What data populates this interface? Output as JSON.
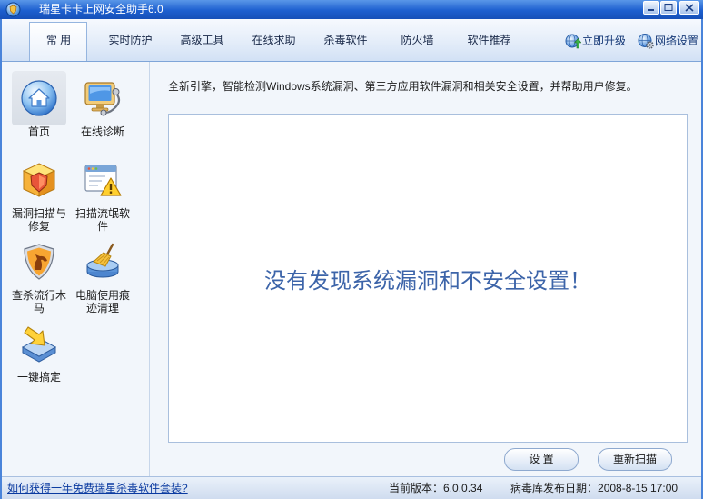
{
  "window": {
    "title": "瑞星卡卡上网安全助手6.0",
    "logo_icon": "app-logo-icon",
    "controls": [
      "minimize-icon",
      "maximize-icon",
      "close-icon"
    ]
  },
  "tabs": [
    {
      "label": "常 用",
      "selected": true
    },
    {
      "label": "实时防护",
      "selected": false
    },
    {
      "label": "高级工具",
      "selected": false
    },
    {
      "label": "在线求助",
      "selected": false
    },
    {
      "label": "杀毒软件",
      "selected": false
    },
    {
      "label": "防火墙",
      "selected": false
    },
    {
      "label": "软件推荐",
      "selected": false
    }
  ],
  "tab_actions": [
    {
      "label": "立即升级",
      "icon": "upgrade-globe-icon"
    },
    {
      "label": "网络设置",
      "icon": "network-settings-icon"
    }
  ],
  "sidebar": {
    "items": [
      {
        "label": "首页",
        "icon": "home-icon",
        "selected": true
      },
      {
        "label": "在线诊断",
        "icon": "monitor-stethoscope-icon",
        "selected": false
      },
      {
        "label": "漏洞扫描与修复",
        "icon": "box-shield-icon",
        "selected": false
      },
      {
        "label": "扫描流氓软件",
        "icon": "window-warning-icon",
        "selected": false
      },
      {
        "label": "查杀流行木马",
        "icon": "shield-horse-icon",
        "selected": false
      },
      {
        "label": "电脑使用痕迹清理",
        "icon": "disk-broom-icon",
        "selected": false
      },
      {
        "label": "一键搞定",
        "icon": "tray-arrow-icon",
        "selected": false
      }
    ]
  },
  "main": {
    "description": "全新引擎，智能检测Windows系统漏洞、第三方应用软件漏洞和相关安全设置，并帮助用户修复。",
    "result_message": "没有发现系统漏洞和不安全设置！",
    "buttons": {
      "settings": "设 置",
      "rescan": "重新扫描"
    }
  },
  "status_bar": {
    "promo_link": "如何获得一年免费瑞星杀毒软件套装?",
    "version_label": "当前版本：",
    "version": "6.0.0.34",
    "db_date_label": "病毒库发布日期：",
    "db_date": "2008-8-15 17:00"
  },
  "colors": {
    "title_bar": "#1d5fcf",
    "result_text": "#3c64a9",
    "link": "#0a3aa0",
    "selected_item_bg": "#d8dee6"
  }
}
